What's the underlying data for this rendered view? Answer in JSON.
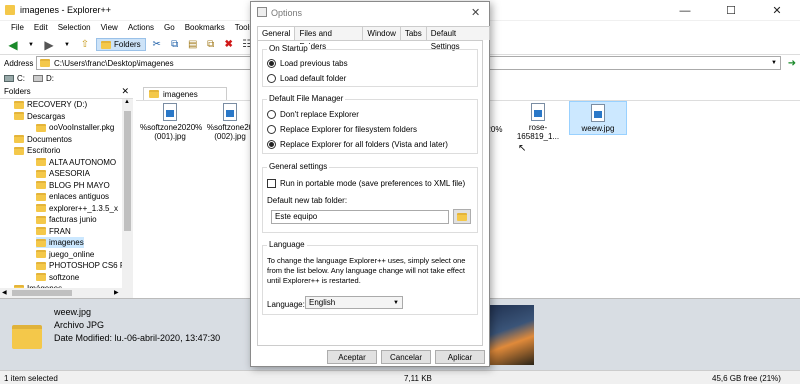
{
  "window": {
    "title": "imagenes - Explorer++"
  },
  "menu": [
    "File",
    "Edit",
    "Selection",
    "View",
    "Actions",
    "Go",
    "Bookmarks",
    "Tools"
  ],
  "toolbar": {
    "folders_label": "Folders"
  },
  "address": {
    "label": "Address",
    "path": "C:\\Users\\franc\\Desktop\\imagenes"
  },
  "drives": [
    "C:",
    "D:"
  ],
  "folders_pane": {
    "title": "Folders"
  },
  "tree": [
    {
      "label": "RECOVERY (D:)",
      "indent": 1
    },
    {
      "label": "Descargas",
      "indent": 1
    },
    {
      "label": "ooVooInstaller.pkg",
      "indent": 2
    },
    {
      "label": "Documentos",
      "indent": 1
    },
    {
      "label": "Escritorio",
      "indent": 1
    },
    {
      "label": "ALTA AUTONOMO",
      "indent": 2
    },
    {
      "label": "ASESORIA",
      "indent": 2
    },
    {
      "label": "BLOG PH MAYO",
      "indent": 2
    },
    {
      "label": "enlaces antiguos",
      "indent": 2
    },
    {
      "label": "explorer++_1.3.5_x",
      "indent": 2
    },
    {
      "label": "facturas junio",
      "indent": 2
    },
    {
      "label": "FRAN",
      "indent": 2
    },
    {
      "label": "imagenes",
      "indent": 2,
      "selected": true
    },
    {
      "label": "juego_online",
      "indent": 2
    },
    {
      "label": "PHOTOSHOP CS6 P",
      "indent": 2
    },
    {
      "label": "softzone",
      "indent": 2
    },
    {
      "label": "Imágenes",
      "indent": 1
    }
  ],
  "files_tab": {
    "label": "imagenes"
  },
  "files": [
    {
      "name": "%softzone2020%\n(001).jpg"
    },
    {
      "name": "%softzone20\n(002).jpg"
    },
    {
      "name": "2020%"
    },
    {
      "name": "rose-165819_1..."
    },
    {
      "name": "weew.jpg",
      "selected": true
    }
  ],
  "preview": {
    "name": "weew.jpg",
    "type": "Archivo JPG",
    "modified": "Date Modified: lu.-06-abril-2020, 13:47:30"
  },
  "status": {
    "selected": "1 item selected",
    "size": "7,11 KB",
    "free": "45,6 GB free (21%)"
  },
  "dialog": {
    "title": "Options",
    "tabs": [
      "General",
      "Files and Folders",
      "Window",
      "Tabs",
      "Default Settings"
    ],
    "startup": {
      "title": "On Startup",
      "options": [
        "Load previous tabs",
        "Load default folder"
      ],
      "selected": 0
    },
    "file_manager": {
      "title": "Default File Manager",
      "options": [
        "Don't replace Explorer",
        "Replace Explorer for filesystem folders",
        "Replace Explorer for all folders (Vista and later)"
      ],
      "selected": 2
    },
    "general": {
      "title": "General settings",
      "portable_label": "Run in portable mode (save preferences to XML file)",
      "portable_checked": false,
      "new_tab_label": "Default new tab folder:",
      "new_tab_value": "Este equipo"
    },
    "language": {
      "title": "Language",
      "description": "To change the language Explorer++ uses, simply select one from the list below. Any language change will not take effect until Explorer++ is restarted.",
      "label": "Language:",
      "value": "English"
    },
    "buttons": {
      "accept": "Aceptar",
      "cancel": "Cancelar",
      "apply": "Aplicar"
    }
  }
}
